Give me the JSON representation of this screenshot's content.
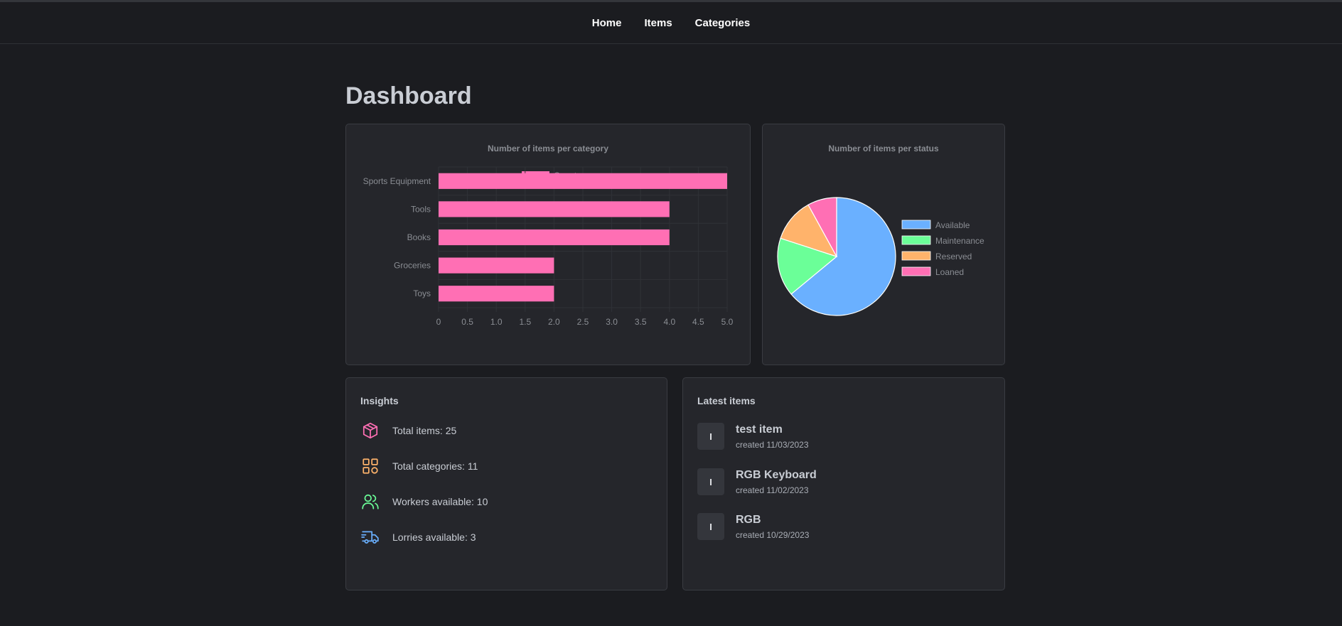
{
  "nav": {
    "links": [
      {
        "label": "Home"
      },
      {
        "label": "Items"
      },
      {
        "label": "Categories"
      }
    ]
  },
  "page": {
    "title": "Dashboard"
  },
  "colors": {
    "background": "#1b1c20",
    "card": "#25262b",
    "bar": "#ff6fb4",
    "available": "#6ab0ff",
    "maintenance": "#6bff98",
    "reserved": "#ffb36b",
    "loaned": "#ff6fb4"
  },
  "chart_data": [
    {
      "type": "bar",
      "orientation": "horizontal",
      "title": "Number of items per category",
      "legend": "top",
      "series": [
        {
          "name": "Count",
          "values": [
            5,
            4,
            4,
            2,
            2
          ]
        }
      ],
      "categories": [
        "Sports Equipment",
        "Tools",
        "Books",
        "Groceries",
        "Toys"
      ],
      "xlim": [
        0,
        5
      ],
      "xticks": [
        "0",
        "0.5",
        "1.0",
        "1.5",
        "2.0",
        "2.5",
        "3.0",
        "3.5",
        "4.0",
        "4.5",
        "5.0"
      ],
      "grid": true
    },
    {
      "type": "pie",
      "title": "Number of items per status",
      "legend": "right",
      "labels": [
        "Available",
        "Maintenance",
        "Reserved",
        "Loaned"
      ],
      "values": [
        16,
        4,
        3,
        2
      ]
    }
  ],
  "insights": {
    "title": "Insights",
    "items": [
      {
        "icon": "cube-icon",
        "text": "Total items: 25"
      },
      {
        "icon": "grid-shapes-icon",
        "text": "Total categories: 11"
      },
      {
        "icon": "users-icon",
        "text": "Workers available: 10"
      },
      {
        "icon": "truck-icon",
        "text": "Lorries available: 3"
      }
    ]
  },
  "latest": {
    "title": "Latest items",
    "items": [
      {
        "initial": "I",
        "name": "test item",
        "date": "created 11/03/2023"
      },
      {
        "initial": "I",
        "name": "RGB Keyboard",
        "date": "created 11/02/2023"
      },
      {
        "initial": "I",
        "name": "RGB",
        "date": "created 10/29/2023"
      }
    ]
  }
}
